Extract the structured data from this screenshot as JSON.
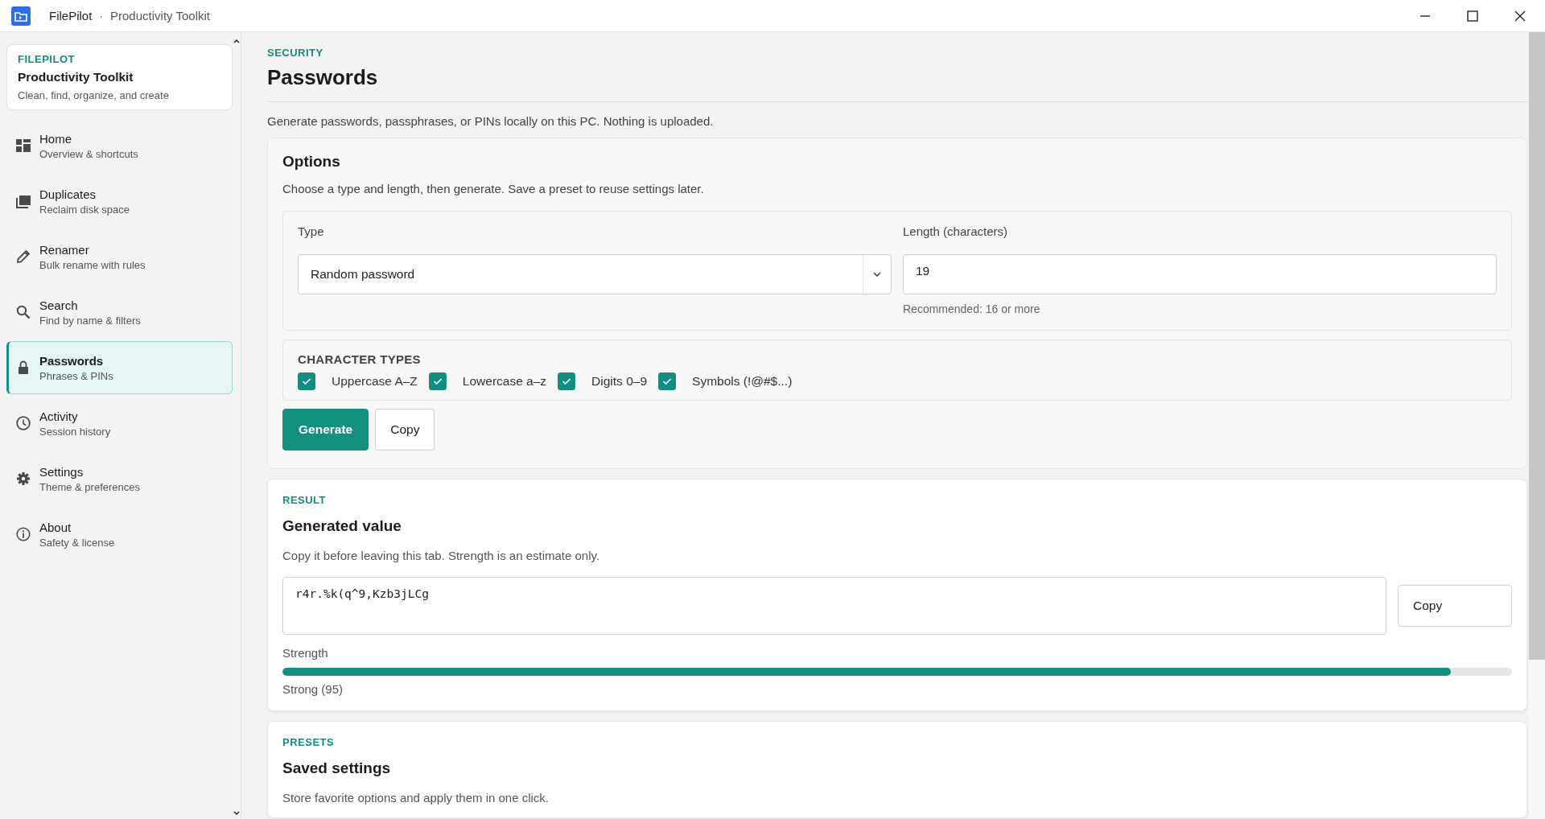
{
  "window": {
    "app_name": "FilePilot",
    "separator": "·",
    "subtitle": "Productivity Toolkit"
  },
  "sidebar": {
    "brand": {
      "eyebrow": "FILEPILOT",
      "title": "Productivity Toolkit",
      "tagline": "Clean, find, organize, and create"
    },
    "items": [
      {
        "label": "Home",
        "caption": "Overview & shortcuts",
        "selected": false
      },
      {
        "label": "Duplicates",
        "caption": "Reclaim disk space",
        "selected": false
      },
      {
        "label": "Renamer",
        "caption": "Bulk rename with rules",
        "selected": false
      },
      {
        "label": "Search",
        "caption": "Find by name & filters",
        "selected": false
      },
      {
        "label": "Passwords",
        "caption": "Phrases & PINs",
        "selected": true
      },
      {
        "label": "Activity",
        "caption": "Session history",
        "selected": false
      },
      {
        "label": "Settings",
        "caption": "Theme & preferences",
        "selected": false
      },
      {
        "label": "About",
        "caption": "Safety & license",
        "selected": false
      }
    ]
  },
  "page": {
    "eyebrow": "SECURITY",
    "title": "Passwords",
    "description": "Generate passwords, passphrases, or PINs locally on this PC. Nothing is uploaded."
  },
  "options": {
    "title": "Options",
    "description": "Choose a type and length, then generate. Save a preset to reuse settings later.",
    "type": {
      "label": "Type",
      "value": "Random password"
    },
    "length": {
      "label": "Length (characters)",
      "value": "19",
      "hint": "Recommended: 16 or more"
    },
    "character_types": {
      "title": "CHARACTER TYPES",
      "items": [
        {
          "label": "Uppercase A–Z",
          "checked": true
        },
        {
          "label": "Lowercase a–z",
          "checked": true
        },
        {
          "label": "Digits 0–9",
          "checked": true
        },
        {
          "label": "Symbols (!@#$...)",
          "checked": true
        }
      ]
    },
    "buttons": [
      {
        "label": "Generate",
        "kind": "primary"
      },
      {
        "label": "Copy",
        "kind": "secondary"
      }
    ]
  },
  "result": {
    "eyebrow": "RESULT",
    "title": "Generated value",
    "description": "Copy it before leaving this tab. Strength is an estimate only.",
    "value": "r4r.%k(q^9,Kzb3jLCg",
    "copy_button": "Copy",
    "strength": {
      "label": "Strength",
      "level": 0.95,
      "reading": "Strong (95)"
    }
  },
  "presets": {
    "eyebrow": "PRESETS",
    "title": "Saved settings",
    "description": "Store favorite options and apply them in one click."
  }
}
